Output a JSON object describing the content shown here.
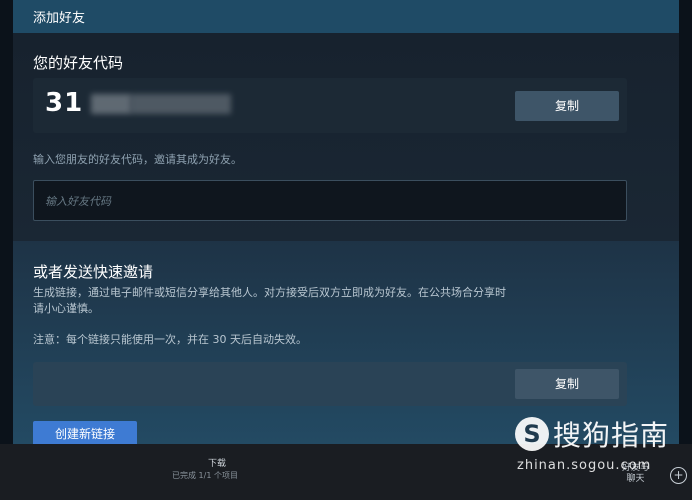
{
  "header": {
    "title": "添加好友"
  },
  "friend_code_section": {
    "heading": "您的好友代码",
    "code_visible": "31",
    "copy_label": "复制",
    "hint": "输入您朋友的好友代码，邀请其成为好友。",
    "input_placeholder": "输入好友代码"
  },
  "invite_section": {
    "heading": "或者发送快速邀请",
    "description_line1": "生成链接，通过电子邮件或短信分享给其他人。对方接受后双方立即成为好友。在公共场合分享时",
    "description_line2": "请小心谨慎。",
    "note": "注意：每个链接只能使用一次，并在 30 天后自动失效。",
    "copy_label": "复制",
    "create_link_label": "创建新链接"
  },
  "footer": {
    "download_title": "下载",
    "download_status": "已完成 1/1 个项目",
    "friends_line1": "好友与",
    "friends_line2": "聊天",
    "plus_icon": "+"
  },
  "watermark": {
    "logo_letter": "S",
    "brand": "搜狗指南",
    "url": "zhinan.sogou.com"
  },
  "colors": {
    "header_bar": "#1f4b66",
    "create_button": "#3e7bd3",
    "copy_button": "#3e5568"
  }
}
